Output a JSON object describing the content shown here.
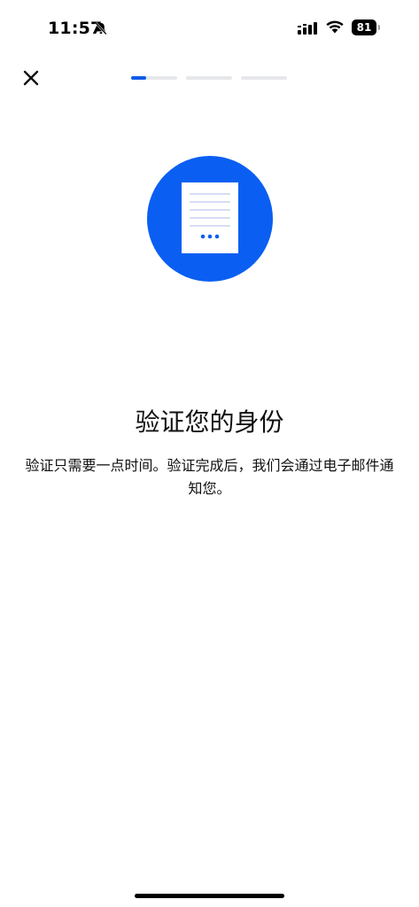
{
  "status_bar": {
    "time": "11:57",
    "battery_level": "81",
    "icons": [
      "bell-slash-icon",
      "signal-icon",
      "wifi-icon",
      "battery-icon"
    ]
  },
  "header": {
    "close_icon": "close-icon",
    "progress": {
      "total_steps": 3,
      "current_step": 1,
      "current_step_fill_fraction": 0.33
    }
  },
  "main": {
    "illustration_icon": "document-icon",
    "title": "验证您的身份",
    "description": "验证只需要一点时间。验证完成后，我们会通过电子邮件通知您。"
  },
  "colors": {
    "accent": "#0a5ff2",
    "progress_active": "#0f5ce6",
    "progress_inactive": "#e6e7ea",
    "doc_lines": "#c9d4f2"
  }
}
